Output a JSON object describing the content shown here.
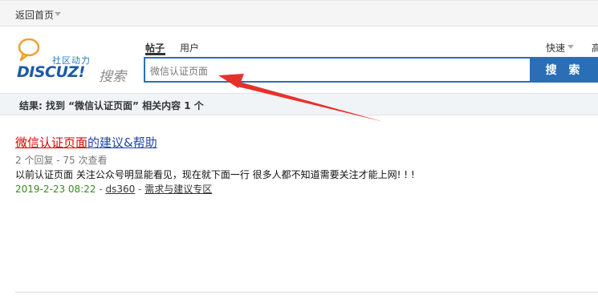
{
  "topbar": {
    "home_label": "返回首页"
  },
  "logo": {
    "sub": "社区动力",
    "word": "DISCUZ!",
    "search_word": "搜索"
  },
  "tabs": {
    "posts": "帖子",
    "users": "用户"
  },
  "right_links": {
    "quick": "快速",
    "advanced": "高"
  },
  "search": {
    "value": "微信认证页面",
    "button_label": "搜 索"
  },
  "results_summary": "结果: 找到 “微信认证页面” 相关内容 1 个",
  "thread": {
    "title_highlight": "微信认证页面",
    "title_rest": "的建议&帮助",
    "stats": "2 个回复 - 75 次查看",
    "snippet": "以前认证页面 关注公众号明显能看见，现在就下面一行 很多人都不知道需要关注才能上网! ! !",
    "date": "2019-2-23 08:22",
    "sep1": " - ",
    "author": "ds360",
    "sep2": " - ",
    "forum": "需求与建议专区"
  },
  "colors": {
    "accent": "#2a6fb6",
    "highlight": "#e00000",
    "date": "#3a8a1e",
    "annotation_arrow": "#e8302a"
  }
}
